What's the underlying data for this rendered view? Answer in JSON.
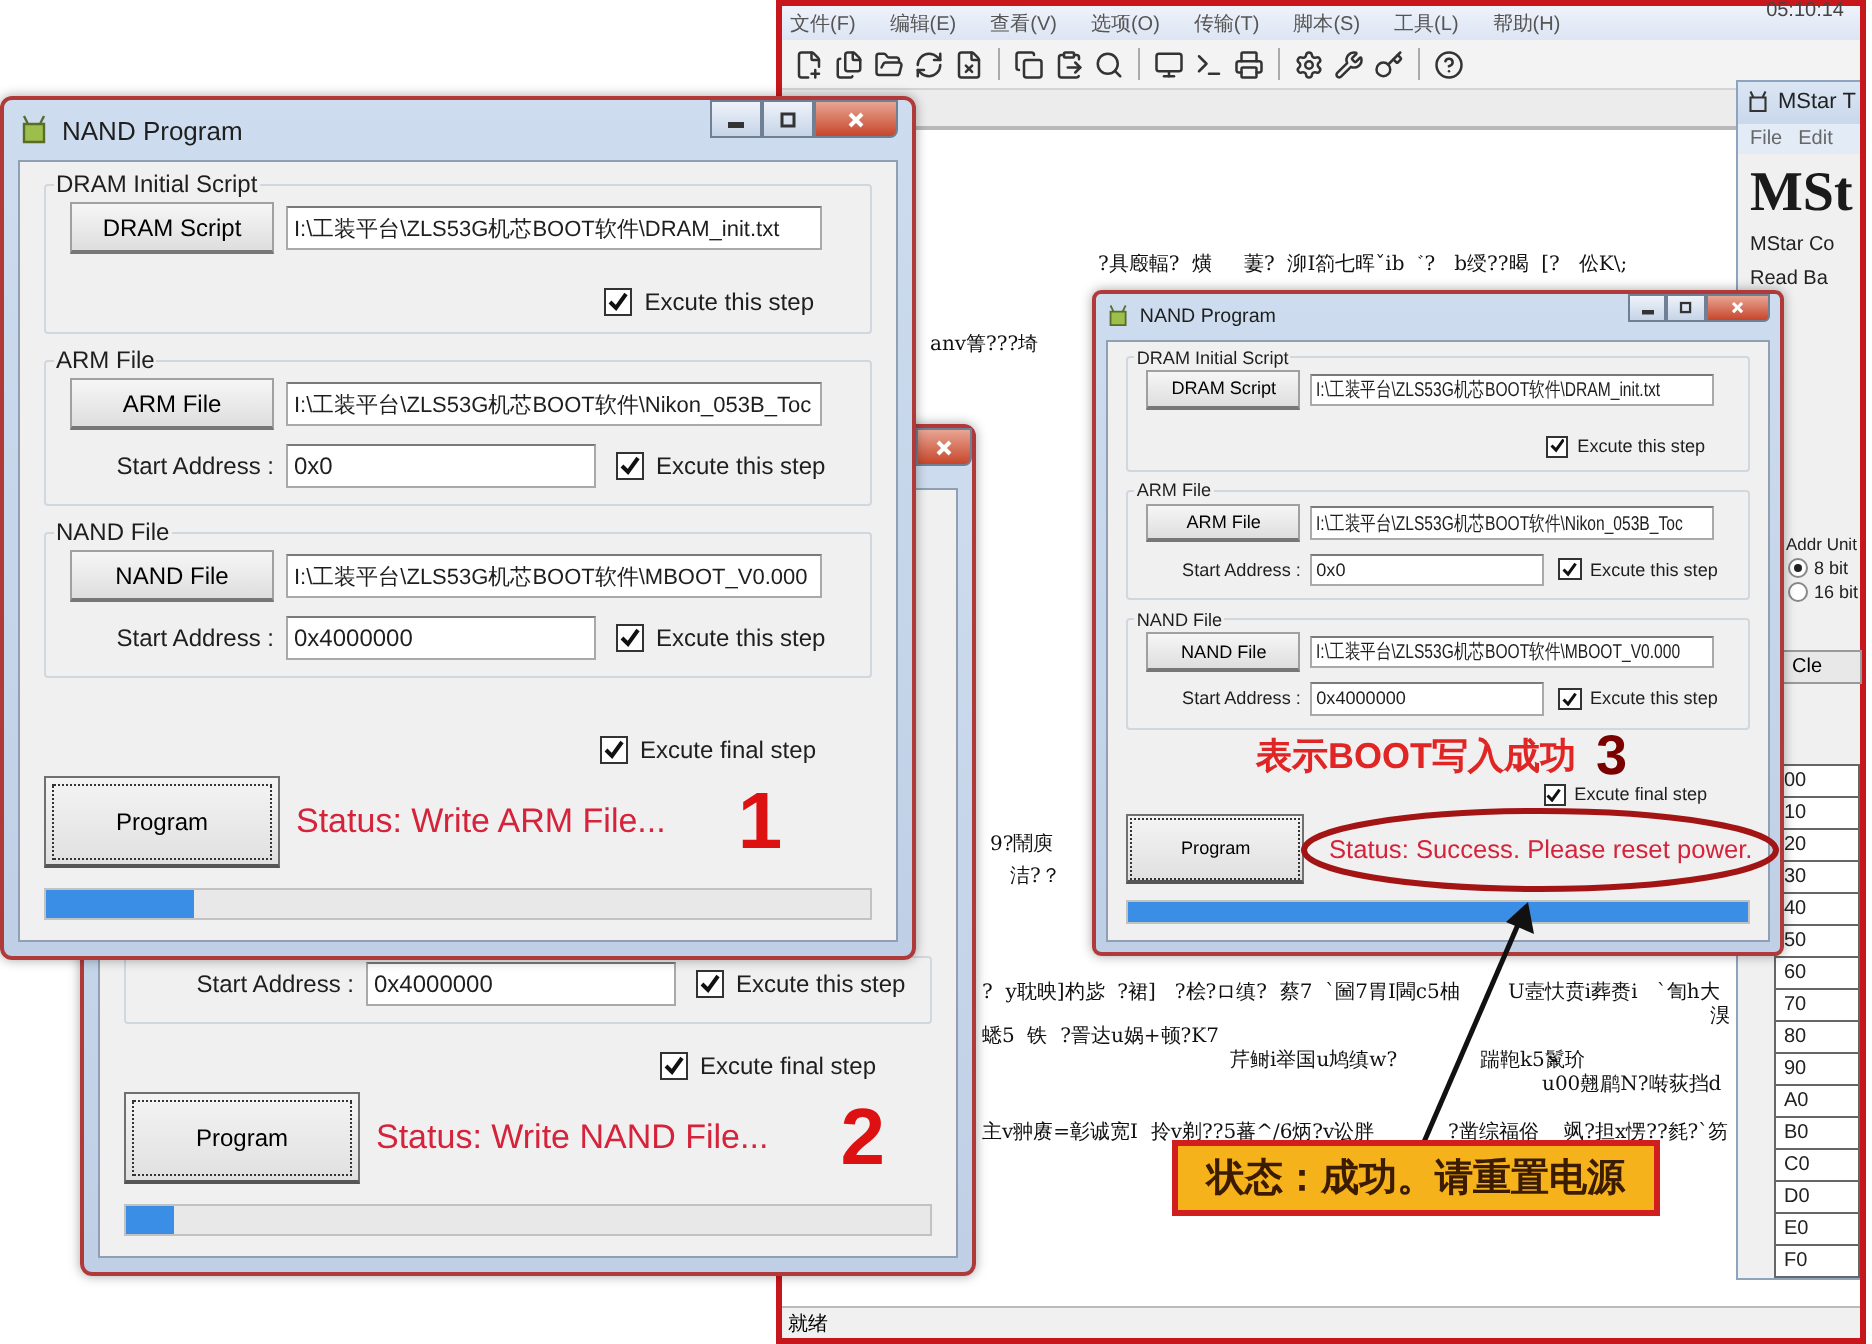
{
  "terminal": {
    "menu": [
      "文件(F)",
      "编辑(E)",
      "查看(V)",
      "选项(O)",
      "传输(T)",
      "脚本(S)",
      "工具(L)",
      "帮助(H)"
    ],
    "time": "05:10:14",
    "lines": [
      {
        "text": "?具廏輻?  熿     萋?  泖I箚七晖ˇib゛?   b绶??暍  [?   伀K\\;"
      },
      {
        "text": "anv箐???埼"
      },
      {
        "text": "9?鬧庾"
      },
      {
        "text": "洁?？"
      },
      {
        "text": "?  y耽映]杓毖  ?裙]   ?桧?ロ缜?  蔡7  `圙7胃I閪c5柚"
      },
      {
        "text": "U壼忕贲i葬赉i   `訇h大"
      },
      {
        "text": "湨"
      },
      {
        "text": "蟋5  铁  ?詈达u娲+顿?K7"
      },
      {
        "text": "芹鲥i举国u鸠缜w?"
      },
      {
        "text": "踹鞄k5鬣玠"
      },
      {
        "text": "u00翹鹛N?啭荻挡d"
      },
      {
        "text": "主v翀赓=彰诚宽I  拎v剃??5蕃^/6炳?v讼胖"
      },
      {
        "text": "?凿综福俗    飒?担x愣??毵?`笏"
      }
    ],
    "status": "就绪"
  },
  "mstar": {
    "title": "MStar T",
    "menu": [
      "File",
      "Edit"
    ],
    "logo": "MSt",
    "subtitle": "MStar Co",
    "read_label": "Read Ba",
    "addr_unit": "Addr Unit",
    "radios": [
      {
        "label": "8 bit",
        "selected": true
      },
      {
        "label": "16 bit",
        "selected": false
      }
    ],
    "button": "Cle",
    "rows": [
      "00",
      "10",
      "20",
      "30",
      "40",
      "50",
      "60",
      "70",
      "80",
      "90",
      "A0",
      "B0",
      "C0",
      "D0",
      "E0",
      "F0"
    ]
  },
  "nand_windows": [
    {
      "title": "NAND Program",
      "groups": [
        {
          "title": "DRAM Initial Script",
          "button": "DRAM Script",
          "path": "I:\\工装平台\\ZLS53G机芯BOOT软件\\DRAM_init.txt",
          "execute": {
            "label": "Excute this step",
            "checked": true
          }
        },
        {
          "title": "ARM File",
          "button": "ARM File",
          "path": "I:\\工装平台\\ZLS53G机芯BOOT软件\\Nikon_053B_Toc",
          "address_label": "Start Address :",
          "address": "0x0",
          "execute": {
            "label": "Excute this step",
            "checked": true
          }
        },
        {
          "title": "NAND File",
          "button": "NAND File",
          "path": "I:\\工装平台\\ZLS53G机芯BOOT软件\\MBOOT_V0.000",
          "address_label": "Start Address :",
          "address": "0x4000000",
          "execute": {
            "label": "Excute this step",
            "checked": true
          }
        }
      ],
      "final_step": {
        "label": "Excute final step",
        "checked": true
      },
      "program_button": "Program",
      "status": "Status: Write ARM File...",
      "step_number": "1",
      "progress": {
        "level": 0.18
      }
    },
    {
      "groups": [
        {
          "address_label": "Start Address :",
          "address": "0x4000000",
          "execute": {
            "label": "Excute this step",
            "checked": true
          }
        }
      ],
      "final_step": {
        "label": "Excute final step",
        "checked": true
      },
      "program_button": "Program",
      "status": "Status: Write NAND File...",
      "step_number": "2",
      "progress": {
        "level": 0.06
      }
    },
    {
      "title": "NAND Program",
      "groups": [
        {
          "title": "DRAM Initial Script",
          "button": "DRAM Script",
          "path": "I:\\工装平台\\ZLS53G机芯BOOT软件\\DRAM_init.txt",
          "execute": {
            "label": "Excute this step",
            "checked": true
          }
        },
        {
          "title": "ARM File",
          "button": "ARM File",
          "path": "I:\\工装平台\\ZLS53G机芯BOOT软件\\Nikon_053B_Toc",
          "address_label": "Start Address :",
          "address": "0x0",
          "execute": {
            "label": "Excute this step",
            "checked": true
          }
        },
        {
          "title": "NAND File",
          "button": "NAND File",
          "path": "I:\\工装平台\\ZLS53G机芯BOOT软件\\MBOOT_V0.000",
          "address_label": "Start Address :",
          "address": "0x4000000",
          "execute": {
            "label": "Excute this step",
            "checked": true
          }
        }
      ],
      "final_step": {
        "label": "Excute final step",
        "checked": true
      },
      "program_button": "Program",
      "status": "Status: Success. Please reset power.",
      "progress": {
        "level": 1
      }
    }
  ],
  "success_note": {
    "text": "表示BOOT写入成功",
    "number": "3"
  },
  "callout": {
    "text": "状态：成功。请重置电源"
  }
}
